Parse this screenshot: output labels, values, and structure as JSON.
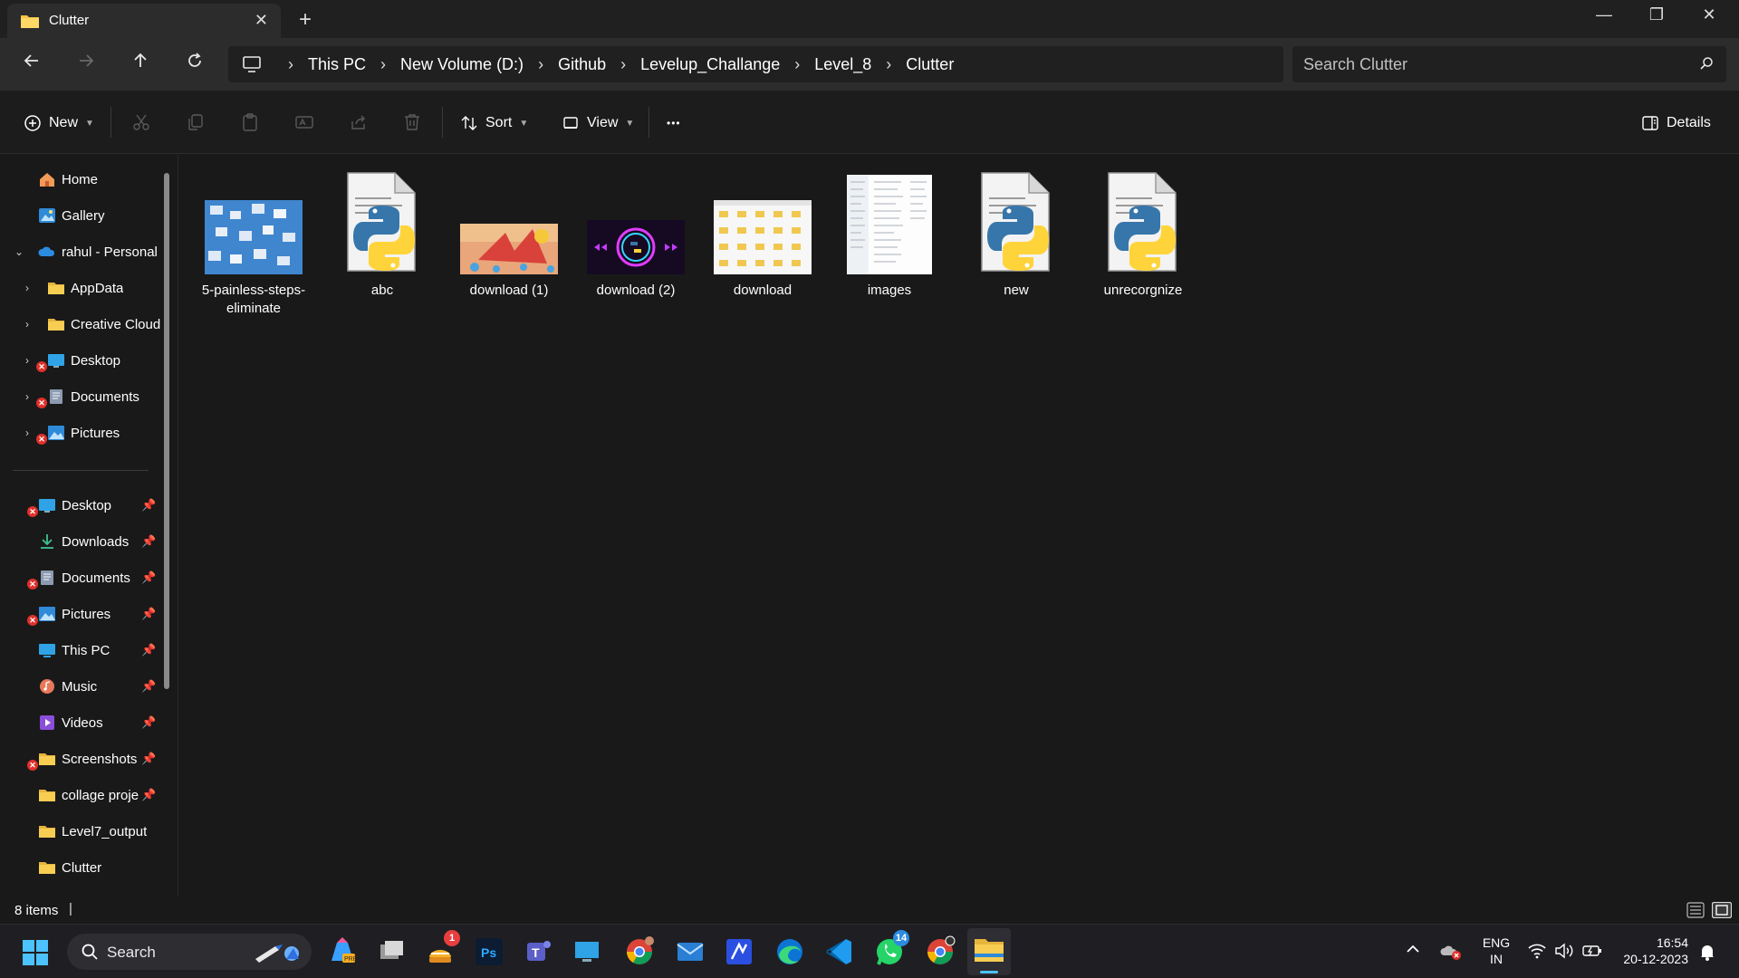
{
  "window": {
    "tab_title": "Clutter",
    "new_tab_symbol": "+",
    "controls": {
      "minimize": "—",
      "maximize": "❐",
      "close": "✕"
    }
  },
  "nav": {
    "breadcrumbs": [
      "This PC",
      "New Volume (D:)",
      "Github",
      "Levelup_Challange",
      "Level_8",
      "Clutter"
    ],
    "breadcrumb_separator": "›",
    "search_placeholder": "Search Clutter"
  },
  "commands": {
    "new_label": "New",
    "sort_label": "Sort",
    "view_label": "View",
    "more_label": "•••",
    "details_label": "Details"
  },
  "sidebar": {
    "top": [
      {
        "label": "Home",
        "icon": "home-icon"
      },
      {
        "label": "Gallery",
        "icon": "gallery-icon"
      },
      {
        "label": "rahul - Personal",
        "icon": "onedrive-icon",
        "expanded": true
      },
      {
        "label": "AppData",
        "icon": "folder-icon"
      },
      {
        "label": "Creative Cloud",
        "icon": "folder-icon"
      },
      {
        "label": "Desktop",
        "icon": "desktop-icon",
        "error": true
      },
      {
        "label": "Documents",
        "icon": "documents-icon",
        "error": true
      },
      {
        "label": "Pictures",
        "icon": "pictures-icon",
        "error": true
      }
    ],
    "quick_access": [
      {
        "label": "Desktop",
        "icon": "desktop-icon",
        "error": true,
        "pinned": true
      },
      {
        "label": "Downloads",
        "icon": "downloads-icon",
        "pinned": true
      },
      {
        "label": "Documents",
        "icon": "documents-icon",
        "error": true,
        "pinned": true
      },
      {
        "label": "Pictures",
        "icon": "pictures-icon",
        "error": true,
        "pinned": true
      },
      {
        "label": "This PC",
        "icon": "pc-icon",
        "pinned": true
      },
      {
        "label": "Music",
        "icon": "music-icon",
        "pinned": true
      },
      {
        "label": "Videos",
        "icon": "videos-icon",
        "pinned": true
      },
      {
        "label": "Screenshots",
        "icon": "folder-icon",
        "error": true,
        "pinned": true
      },
      {
        "label": "collage proje",
        "icon": "folder-icon",
        "pinned": true
      },
      {
        "label": "Level7_output",
        "icon": "folder-icon"
      },
      {
        "label": "Clutter",
        "icon": "folder-icon"
      }
    ]
  },
  "files": [
    {
      "name": "5-painless-steps-eliminate",
      "kind": "image-blue"
    },
    {
      "name": "abc",
      "kind": "python"
    },
    {
      "name": "download (1)",
      "kind": "image-ocean"
    },
    {
      "name": "download (2)",
      "kind": "image-neon"
    },
    {
      "name": "download",
      "kind": "image-grid"
    },
    {
      "name": "images",
      "kind": "image-list"
    },
    {
      "name": "new",
      "kind": "python"
    },
    {
      "name": "unrecorgnize",
      "kind": "python"
    }
  ],
  "status": {
    "item_count": "8 items",
    "caret": "|"
  },
  "taskbar": {
    "search_label": "Search",
    "badges": {
      "notes": "1",
      "whatsapp": "14"
    },
    "language": "ENG",
    "region": "IN",
    "time": "16:54",
    "date": "20-12-2023"
  },
  "colors": {
    "accent": "#4cc2ff",
    "folder": "#f5c542",
    "python_blue": "#3776ab",
    "python_yellow": "#ffd43b",
    "error": "#e0302a"
  }
}
